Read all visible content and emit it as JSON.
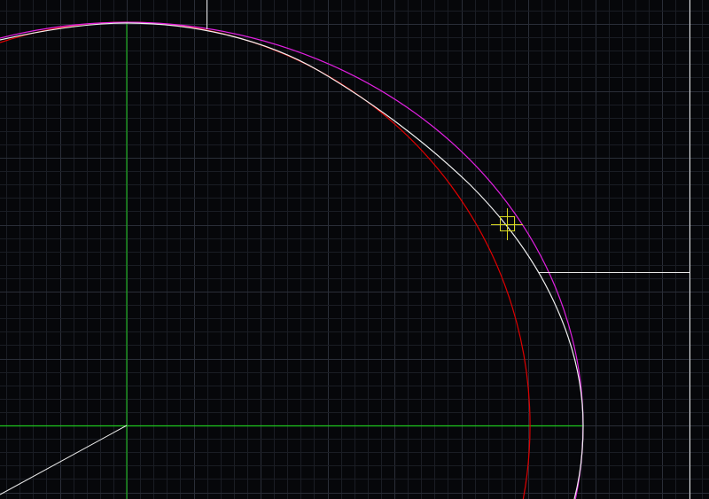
{
  "viewport": {
    "background": "#06070a",
    "grid_minor_color": "#1a1d24",
    "grid_major_color": "#2a2e38"
  },
  "entities": {
    "axis_color": "#1ec81e",
    "circle_color": "#e00000",
    "ellipse_color": "#e020e0",
    "spline_color": "#f0f0f0",
    "line_color": "#e8e8e8",
    "cursor_color": "#d8d820"
  }
}
